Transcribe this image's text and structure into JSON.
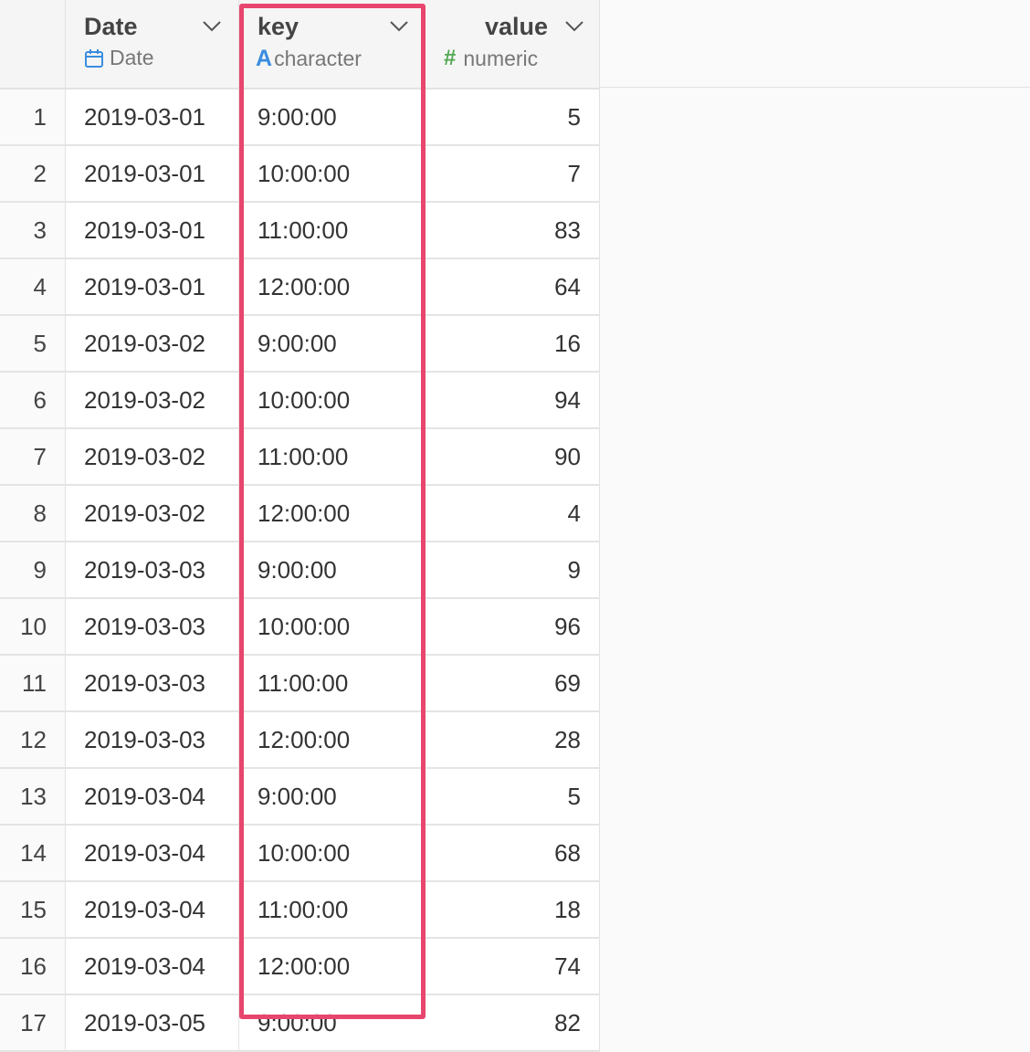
{
  "columns": [
    {
      "name": "Date",
      "type": "Date",
      "icon": "calendar-icon"
    },
    {
      "name": "key",
      "type": "character",
      "icon": "character-type-icon",
      "icon_glyph": "A"
    },
    {
      "name": "value",
      "type": "numeric",
      "icon": "numeric-type-icon",
      "icon_glyph": "#"
    }
  ],
  "highlight_color": "#e8466e",
  "rows": [
    {
      "n": "1",
      "date": "2019-03-01",
      "key": "9:00:00",
      "value": "5"
    },
    {
      "n": "2",
      "date": "2019-03-01",
      "key": "10:00:00",
      "value": "7"
    },
    {
      "n": "3",
      "date": "2019-03-01",
      "key": "11:00:00",
      "value": "83"
    },
    {
      "n": "4",
      "date": "2019-03-01",
      "key": "12:00:00",
      "value": "64"
    },
    {
      "n": "5",
      "date": "2019-03-02",
      "key": "9:00:00",
      "value": "16"
    },
    {
      "n": "6",
      "date": "2019-03-02",
      "key": "10:00:00",
      "value": "94"
    },
    {
      "n": "7",
      "date": "2019-03-02",
      "key": "11:00:00",
      "value": "90"
    },
    {
      "n": "8",
      "date": "2019-03-02",
      "key": "12:00:00",
      "value": "4"
    },
    {
      "n": "9",
      "date": "2019-03-03",
      "key": "9:00:00",
      "value": "9"
    },
    {
      "n": "10",
      "date": "2019-03-03",
      "key": "10:00:00",
      "value": "96"
    },
    {
      "n": "11",
      "date": "2019-03-03",
      "key": "11:00:00",
      "value": "69"
    },
    {
      "n": "12",
      "date": "2019-03-03",
      "key": "12:00:00",
      "value": "28"
    },
    {
      "n": "13",
      "date": "2019-03-04",
      "key": "9:00:00",
      "value": "5"
    },
    {
      "n": "14",
      "date": "2019-03-04",
      "key": "10:00:00",
      "value": "68"
    },
    {
      "n": "15",
      "date": "2019-03-04",
      "key": "11:00:00",
      "value": "18"
    },
    {
      "n": "16",
      "date": "2019-03-04",
      "key": "12:00:00",
      "value": "74"
    },
    {
      "n": "17",
      "date": "2019-03-05",
      "key": "9:00:00",
      "value": "82"
    }
  ]
}
